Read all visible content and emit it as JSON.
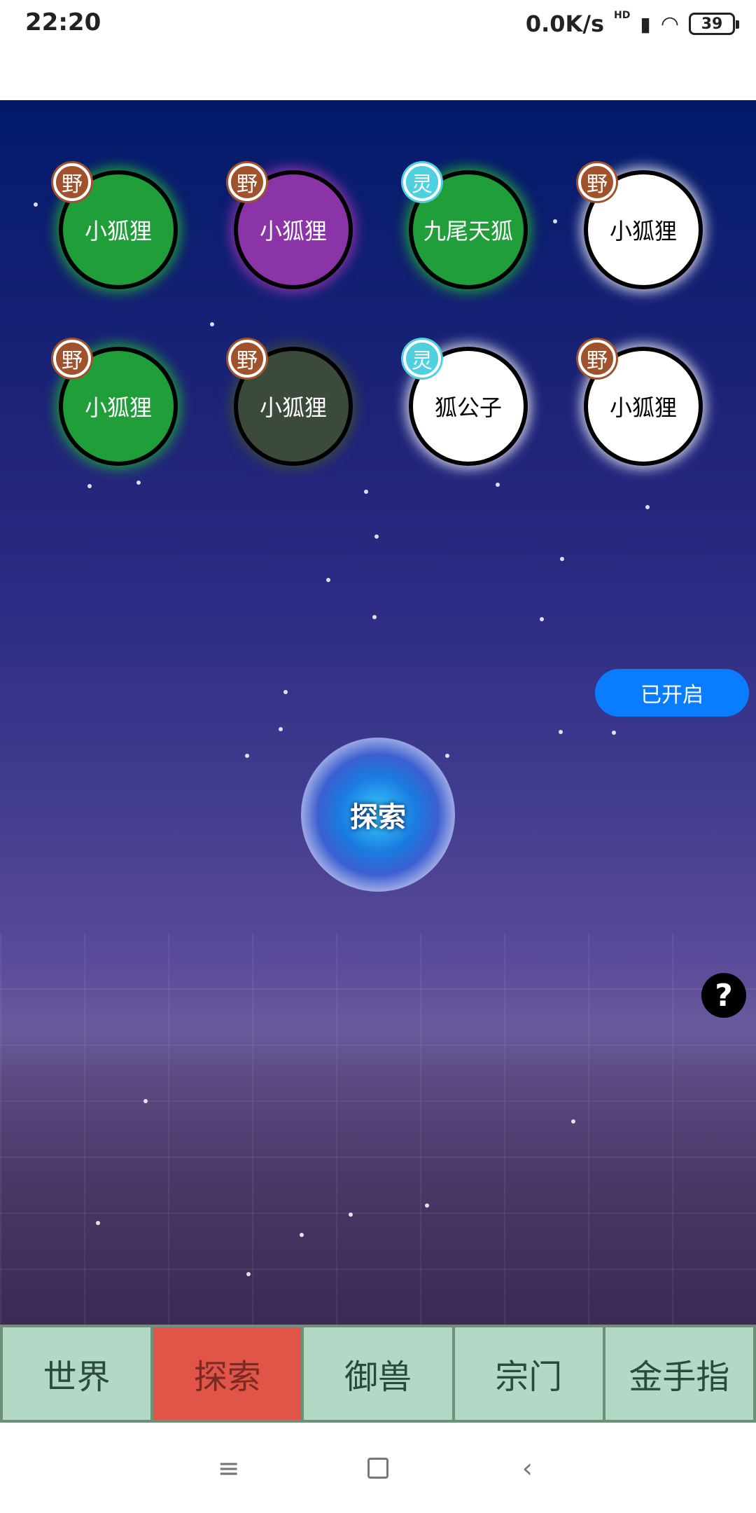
{
  "status": {
    "time": "22:20",
    "net_speed": "0.0K/s",
    "network": "HD",
    "battery": "39"
  },
  "creatures": [
    {
      "name": "小狐狸",
      "badge": "野",
      "badge_type": "wild",
      "fill": "#1f9e3a",
      "text_color": "#ffffff"
    },
    {
      "name": "小狐狸",
      "badge": "野",
      "badge_type": "wild",
      "fill": "#8b34a8",
      "text_color": "#ffffff"
    },
    {
      "name": "九尾天狐",
      "badge": "灵",
      "badge_type": "spirit",
      "fill": "#1f9e3a",
      "text_color": "#ffffff"
    },
    {
      "name": "小狐狸",
      "badge": "野",
      "badge_type": "wild",
      "fill": "#ffffff",
      "text_color": "#000000"
    },
    {
      "name": "小狐狸",
      "badge": "野",
      "badge_type": "wild",
      "fill": "#1f9e3a",
      "text_color": "#ffffff"
    },
    {
      "name": "小狐狸",
      "badge": "野",
      "badge_type": "wild",
      "fill": "#3c4a3c",
      "text_color": "#ffffff"
    },
    {
      "name": "狐公子",
      "badge": "灵",
      "badge_type": "spirit",
      "fill": "#ffffff",
      "text_color": "#000000"
    },
    {
      "name": "小狐狸",
      "badge": "野",
      "badge_type": "wild",
      "fill": "#ffffff",
      "text_color": "#000000"
    }
  ],
  "toggle": {
    "label": "已开启",
    "color": "#0a7cff"
  },
  "explore": {
    "label": "探索"
  },
  "help": {
    "label": "?"
  },
  "tabs": [
    {
      "label": "世界",
      "active": false
    },
    {
      "label": "探索",
      "active": true
    },
    {
      "label": "御兽",
      "active": false
    },
    {
      "label": "宗门",
      "active": false
    },
    {
      "label": "金手指",
      "active": false
    }
  ],
  "nav": {
    "menu_icon": "menu-icon",
    "home_icon": "home-square-icon",
    "back_icon": "back-chevron-icon"
  }
}
